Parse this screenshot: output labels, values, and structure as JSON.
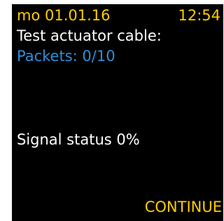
{
  "status_bar": {
    "date": "mo 01.01.16",
    "time": "12:54"
  },
  "main": {
    "title": "Test actuator cable:",
    "packets": "Packets: 0/10",
    "signal_status": "Signal status 0%"
  },
  "softkeys": {
    "continue_label": "CONTINUE"
  },
  "colors": {
    "background": "#000000",
    "accent_yellow": "#ffcc00",
    "text_white": "#ffffff",
    "info_blue": "#2f8fd9"
  }
}
